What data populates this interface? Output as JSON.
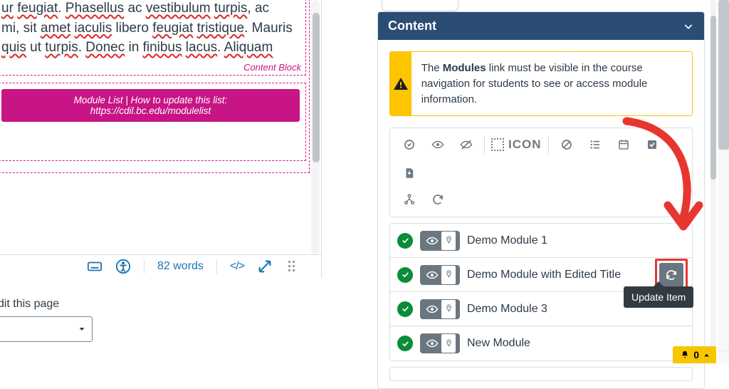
{
  "editor": {
    "paragraph_html": "<span class='spell'>ur</span> <span class='spell'>feugiat</span>. <span class='spell'>Phasellus</span> ac <span class='spell'>vestibulum</span> <span class='spell'>turpis</span>, ac <br>mi, sit <span class='spell'>amet</span> <span class='spell'>iaculis</span> libero <span class='spell'>feugiat</span> <span class='spell'>tristique</span>. Mauris <br><span class='spell'>quis</span> ut <span class='spell'>turpis</span>. <span class='spell'>Donec</span> in <span class='spell'>finibus</span> <span class='spell'>lacus</span>. <span class='spell'>Aliquam</span>",
    "content_block_label": "Content Block",
    "module_pill_line1": "Module List | How to update this list:",
    "module_pill_line2": "https://cdil.bc.edu/modulelist",
    "word_count": "82 words",
    "code_tag_label": "</>"
  },
  "below": {
    "edit_label": "edit this page"
  },
  "panel": {
    "title": "Content",
    "alert_pre": "The ",
    "alert_bold": "Modules",
    "alert_post": " link must be visible in the course navigation for students to see or access module information.",
    "icon_placeholder": "ICON",
    "modules": [
      {
        "title": "Demo Module 1",
        "has_refresh": false
      },
      {
        "title": "Demo Module with Edited Title",
        "has_refresh": true
      },
      {
        "title": "Demo Module 3",
        "has_refresh": false
      },
      {
        "title": "New Module",
        "has_refresh": false
      }
    ],
    "tooltip": "Update Item"
  },
  "notif": {
    "count": "0"
  }
}
